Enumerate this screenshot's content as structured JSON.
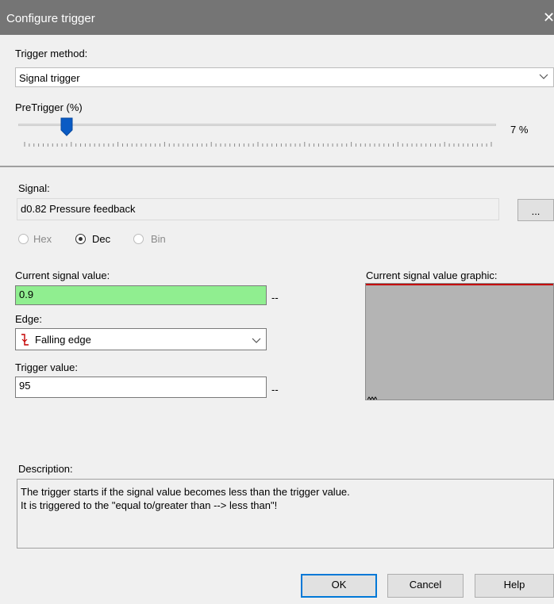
{
  "dialog": {
    "title": "Configure trigger",
    "close_glyph": "✕"
  },
  "trigger_method": {
    "label": "Trigger method:",
    "value": "Signal trigger"
  },
  "pretrigger": {
    "label": "PreTrigger (%)",
    "value": 7,
    "value_text": "7 %",
    "accent_color": "#0a5bc4"
  },
  "signal": {
    "label": "Signal:",
    "value": "d0.82 Pressure feedback",
    "browse_label": "..."
  },
  "format": {
    "options": [
      "Hex",
      "Dec",
      "Bin"
    ],
    "selected": "Dec"
  },
  "current_value": {
    "label": "Current signal value:",
    "value": "0.9",
    "unit": "--",
    "bg_color": "#90ee90"
  },
  "edge": {
    "label": "Edge:",
    "value": "Falling edge",
    "icon": "falling-edge-icon"
  },
  "trigger_value": {
    "label": "Trigger value:",
    "value": "95",
    "unit": "--"
  },
  "graphic": {
    "label": "Current signal value graphic:",
    "line_color": "#c40000"
  },
  "description": {
    "label": "Description:",
    "line1": "The trigger starts if the signal value becomes less than the trigger value.",
    "line2": "It is triggered to the \"equal to/greater than --> less than\"!"
  },
  "buttons": {
    "ok": "OK",
    "cancel": "Cancel",
    "help": "Help"
  }
}
